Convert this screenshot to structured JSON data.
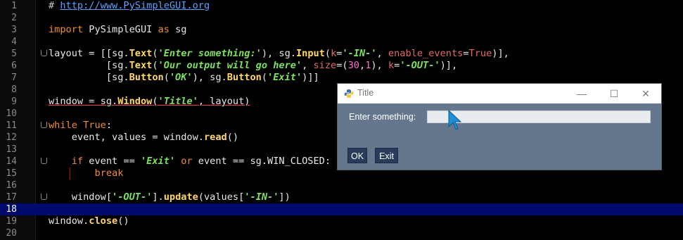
{
  "editor": {
    "lines": [
      {
        "num": "1"
      },
      {
        "num": "2"
      },
      {
        "num": "3"
      },
      {
        "num": "4"
      },
      {
        "num": "5"
      },
      {
        "num": "6"
      },
      {
        "num": "7"
      },
      {
        "num": "8"
      },
      {
        "num": "9"
      },
      {
        "num": "10"
      },
      {
        "num": "11"
      },
      {
        "num": "12"
      },
      {
        "num": "13"
      },
      {
        "num": "14"
      },
      {
        "num": "15"
      },
      {
        "num": "16"
      },
      {
        "num": "17"
      },
      {
        "num": "18"
      },
      {
        "num": "19"
      },
      {
        "num": "20"
      }
    ],
    "current_line": "18",
    "code": {
      "l1_hash": "# ",
      "l1_url": "http://www.PySimpleGUI.org",
      "l3_import": "import",
      "l3_module": " PySimpleGUI ",
      "l3_as": "as",
      "l3_alias": " sg",
      "l5_a": "layout = [[sg.",
      "l5_text": "Text",
      "l5_b": "(",
      "l5_s1": "'Enter something:'",
      "l5_c": "), sg.",
      "l5_input": "Input",
      "l5_d": "(",
      "l5_k": "k",
      "l5_e": "=",
      "l5_s2": "'-IN-'",
      "l5_f": ", ",
      "l5_ev": "enable_events",
      "l5_g": "=",
      "l5_true": "True",
      "l5_h": ")],",
      "l6_a": "          [sg.",
      "l6_text": "Text",
      "l6_b": "(",
      "l6_s1": "'Our output will go here'",
      "l6_c": ", ",
      "l6_size": "size",
      "l6_d": "=(",
      "l6_n1": "30",
      "l6_e": ",",
      "l6_n2": "1",
      "l6_f": "), ",
      "l6_k": "k",
      "l6_g": "=",
      "l6_s2": "'-OUT-'",
      "l6_h": ")],",
      "l7_a": "          [sg.",
      "l7_button": "Button",
      "l7_b": "(",
      "l7_s1": "'OK'",
      "l7_c": "), sg.",
      "l7_button2": "Button",
      "l7_d": "(",
      "l7_s2": "'Exit'",
      "l7_e": ")]]",
      "l9_a": "window = sg.",
      "l9_win": "Window",
      "l9_b": "(",
      "l9_s1": "'Title'",
      "l9_c": ", layout)",
      "l11_while": "while",
      "l11_true": " True",
      "l11_a": ":",
      "l12_a": "    event, values = window.",
      "l12_read": "read",
      "l12_b": "()",
      "l14_if": "    if",
      "l14_a": " event == ",
      "l14_s1": "'Exit'",
      "l14_or": " or",
      "l14_b": " event == sg.WIN_CLOSED:",
      "l15_break": "        break",
      "l17_a": "    window[",
      "l17_s1": "'-OUT-'",
      "l17_b": "].",
      "l17_update": "update",
      "l17_c": "(values[",
      "l17_s2": "'-IN-'",
      "l17_d": "])",
      "l19_a": "window.",
      "l19_close": "close",
      "l19_b": "()"
    }
  },
  "gui_window": {
    "title": "Title",
    "minimize": "—",
    "maximize": "☐",
    "close": "✕",
    "label": "Enter something:",
    "input_value": "",
    "ok_label": "OK",
    "exit_label": "Exit",
    "colors": {
      "background": "#64778d",
      "button": "#283b5b",
      "titlebar": "#ffffff"
    }
  }
}
